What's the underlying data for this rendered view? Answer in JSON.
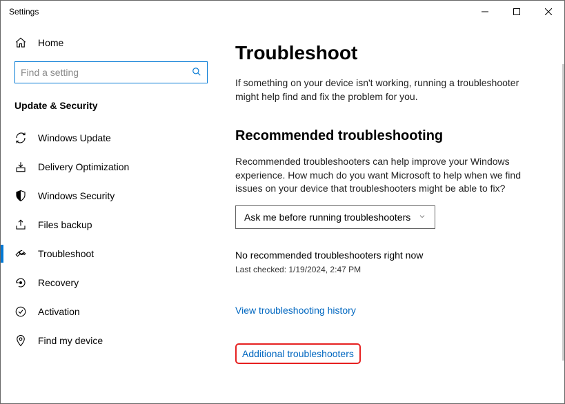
{
  "window": {
    "title": "Settings"
  },
  "sidebar": {
    "home_label": "Home",
    "search_placeholder": "Find a setting",
    "section_title": "Update & Security",
    "items": [
      {
        "label": "Windows Update"
      },
      {
        "label": "Delivery Optimization"
      },
      {
        "label": "Windows Security"
      },
      {
        "label": "Files backup"
      },
      {
        "label": "Troubleshoot"
      },
      {
        "label": "Recovery"
      },
      {
        "label": "Activation"
      },
      {
        "label": "Find my device"
      }
    ]
  },
  "main": {
    "heading": "Troubleshoot",
    "intro": "If something on your device isn't working, running a troubleshooter might help find and fix the problem for you.",
    "recommended_heading": "Recommended troubleshooting",
    "recommended_desc": "Recommended troubleshooters can help improve your Windows experience. How much do you want Microsoft to help when we find issues on your device that troubleshooters might be able to fix?",
    "dropdown_value": "Ask me before running troubleshooters",
    "no_recommended": "No recommended troubleshooters right now",
    "last_checked": "Last checked: 1/19/2024, 2:47 PM",
    "history_link": "View troubleshooting history",
    "additional_link": "Additional troubleshooters"
  }
}
